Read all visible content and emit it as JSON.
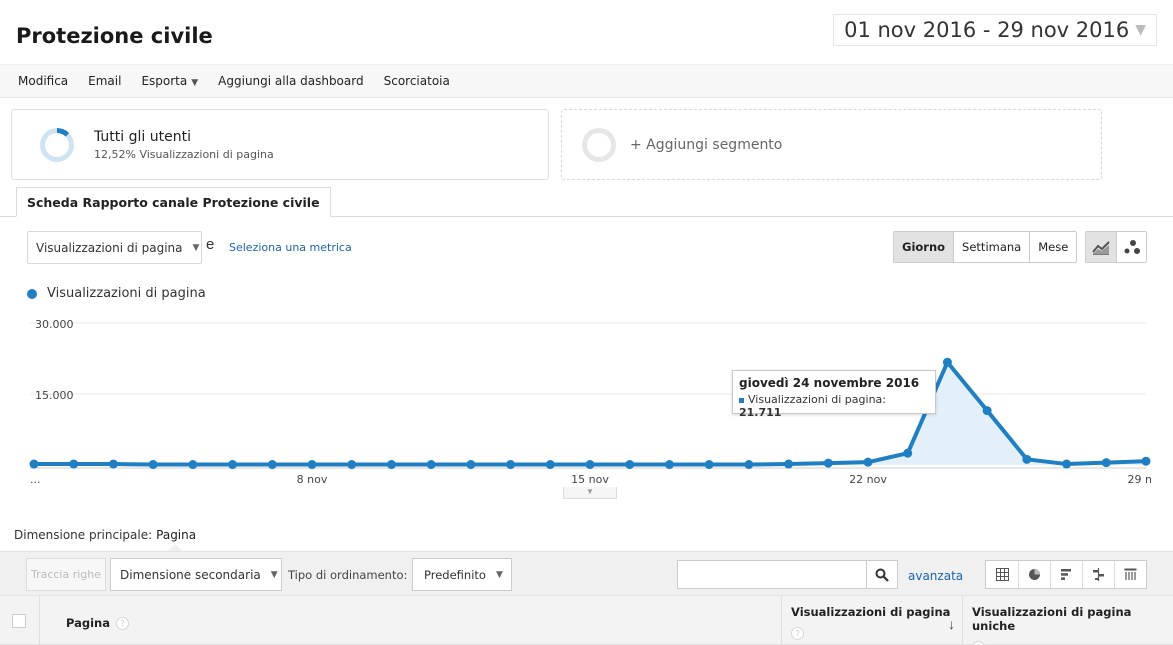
{
  "header": {
    "title": "Protezione civile",
    "date_range": "01 nov 2016 - 29 nov 2016"
  },
  "actions": [
    "Modifica",
    "Email",
    "Esporta",
    "Aggiungi alla dashboard",
    "Scorciatoia"
  ],
  "segments": {
    "primary": {
      "name": "Tutti gli utenti",
      "share": "12,52% Visualizzazioni di pagina",
      "share_value": 0.1252
    },
    "add_label": "+ Aggiungi segmento"
  },
  "tab": "Scheda Rapporto canale Protezione civile",
  "metric": {
    "selected": "Visualizzazioni di pagina",
    "and": "e",
    "select_metric": "Seleziona una metrica"
  },
  "period": [
    "Giorno",
    "Settimana",
    "Mese"
  ],
  "colors": {
    "series": "#1f7fc2",
    "link": "#1a64b0"
  },
  "chart_data": {
    "type": "line",
    "series": [
      {
        "name": "Visualizzazioni di pagina",
        "values": [
          200,
          200,
          200,
          100,
          100,
          100,
          100,
          100,
          100,
          100,
          100,
          100,
          100,
          100,
          100,
          100,
          100,
          100,
          100,
          200,
          400,
          600,
          2500,
          21711,
          11500,
          1200,
          200,
          500,
          800
        ]
      }
    ],
    "x": [
      "1 nov",
      "2 nov",
      "3 nov",
      "4 nov",
      "5 nov",
      "6 nov",
      "7 nov",
      "8 nov",
      "9 nov",
      "10 nov",
      "11 nov",
      "12 nov",
      "13 nov",
      "14 nov",
      "15 nov",
      "16 nov",
      "17 nov",
      "18 nov",
      "19 nov",
      "20 nov",
      "21 nov",
      "22 nov",
      "23 nov",
      "24 nov",
      "25 nov",
      "26 nov",
      "27 nov",
      "28 nov",
      "29 nov"
    ],
    "ylim": [
      0,
      30000
    ],
    "y_ticks": [
      "30.000",
      "15.000"
    ],
    "x_tick_labels": [
      "...",
      "8 nov",
      "15 nov",
      "22 nov",
      "29 n"
    ],
    "grid": true,
    "tooltip": {
      "date": "giovedì 24 novembre 2016",
      "label": "Visualizzazioni di pagina:",
      "value": "21.711"
    }
  },
  "table": {
    "primary_dimension_label": "Dimensione principale:",
    "primary_dimension_value": "Pagina",
    "plot_rows": "Traccia righe",
    "secondary_dimension": "Dimensione secondaria",
    "sort_type_label": "Tipo di ordinamento:",
    "sort_type_value": "Predefinito",
    "advanced": "avanzata",
    "columns": [
      "Pagina",
      "Visualizzazioni di pagina",
      "Visualizzazioni di pagina uniche"
    ],
    "help": "?"
  }
}
